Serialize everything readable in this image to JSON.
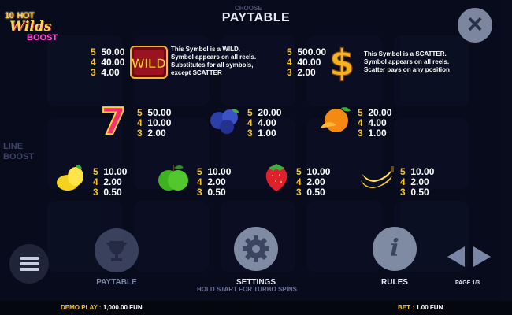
{
  "header": {
    "title": "PAYTABLE",
    "choose": "CHOOSE"
  },
  "logo": {
    "line1": "10",
    "line1b": "HOT",
    "line2": "Wilds",
    "line3": "BOOST"
  },
  "side_text": "LINE BOOST",
  "close_icon": "×",
  "symbols": {
    "wild": {
      "label": "WILD",
      "pays": [
        {
          "n": "5",
          "v": "50.00"
        },
        {
          "n": "4",
          "v": "40.00"
        },
        {
          "n": "3",
          "v": "4.00"
        }
      ],
      "desc": [
        "This Symbol is a WILD.",
        "Symbol appears on all reels.",
        "Substitutes for all symbols,",
        "except SCATTER"
      ]
    },
    "scatter": {
      "label": "$",
      "pays": [
        {
          "n": "5",
          "v": "500.00"
        },
        {
          "n": "4",
          "v": "40.00"
        },
        {
          "n": "3",
          "v": "2.00"
        }
      ],
      "desc": [
        "This Symbol is a SCATTER.",
        "Symbol appears on all reels.",
        "Scatter pays on any position"
      ]
    },
    "seven": {
      "label": "7",
      "pays": [
        {
          "n": "5",
          "v": "50.00"
        },
        {
          "n": "4",
          "v": "10.00"
        },
        {
          "n": "3",
          "v": "2.00"
        }
      ]
    },
    "blueberry": {
      "pays": [
        {
          "n": "5",
          "v": "20.00"
        },
        {
          "n": "4",
          "v": "4.00"
        },
        {
          "n": "3",
          "v": "1.00"
        }
      ]
    },
    "orange": {
      "pays": [
        {
          "n": "5",
          "v": "20.00"
        },
        {
          "n": "4",
          "v": "4.00"
        },
        {
          "n": "3",
          "v": "1.00"
        }
      ]
    },
    "lemon": {
      "pays": [
        {
          "n": "5",
          "v": "10.00"
        },
        {
          "n": "4",
          "v": "2.00"
        },
        {
          "n": "3",
          "v": "0.50"
        }
      ]
    },
    "apple": {
      "pays": [
        {
          "n": "5",
          "v": "10.00"
        },
        {
          "n": "4",
          "v": "2.00"
        },
        {
          "n": "3",
          "v": "0.50"
        }
      ]
    },
    "strawberry": {
      "pays": [
        {
          "n": "5",
          "v": "10.00"
        },
        {
          "n": "4",
          "v": "2.00"
        },
        {
          "n": "3",
          "v": "0.50"
        }
      ]
    },
    "banana": {
      "pays": [
        {
          "n": "5",
          "v": "10.00"
        },
        {
          "n": "4",
          "v": "2.00"
        },
        {
          "n": "3",
          "v": "0.50"
        }
      ]
    }
  },
  "buttons": {
    "paytable": {
      "label": "PAYTABLE",
      "icon": "trophy-icon"
    },
    "settings": {
      "label": "SETTINGS",
      "icon": "gear-icon"
    },
    "rules": {
      "label": "RULES",
      "icon": "info-icon",
      "glyph": "i"
    }
  },
  "hold_text": "HOLD START FOR TURBO SPINS",
  "page_indicator": "PAGE 1/3",
  "footer": {
    "demo_label": "DEMO PLAY :",
    "demo_value": "1,000.00 FUN",
    "bet_label": "BET :",
    "bet_value": "1.00 FUN"
  },
  "colors": {
    "accent": "#f7c42a",
    "background": "#0b1024",
    "button": "#7f8aa3",
    "arrow": "#7a86a6"
  }
}
